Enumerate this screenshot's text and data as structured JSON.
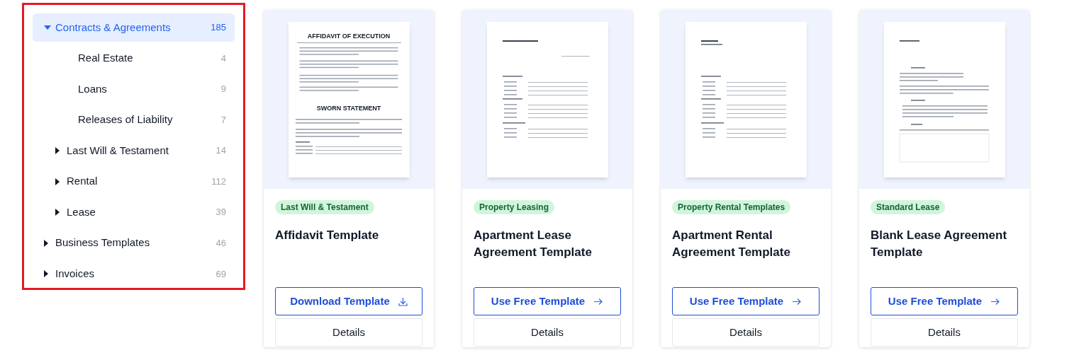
{
  "sidebar": {
    "highlighted": true,
    "items": [
      {
        "label": "Contracts & Agreements",
        "count": "185",
        "expanded": true,
        "selected": true,
        "children": [
          {
            "label": "Real Estate",
            "count": "4",
            "selected": false
          },
          {
            "label": "Loans",
            "count": "9",
            "selected": false
          },
          {
            "label": "Releases of Liability",
            "count": "7",
            "selected": false
          },
          {
            "label": "Last Will & Testament",
            "count": "14",
            "expanded": false,
            "selected": false
          },
          {
            "label": "Rental",
            "count": "112",
            "expanded": false,
            "selected": false
          },
          {
            "label": "Lease",
            "count": "39",
            "expanded": false,
            "selected": false
          }
        ]
      },
      {
        "label": "Business Templates",
        "count": "46",
        "expanded": false,
        "selected": false
      },
      {
        "label": "Invoices",
        "count": "69",
        "expanded": false,
        "selected": false
      }
    ]
  },
  "cards": [
    {
      "preview": {
        "kind": "affidavit",
        "headings": [
          "AFFIDAVIT OF EXECUTION",
          "SWORN STATEMENT"
        ]
      },
      "badge": "Last Will & Testament",
      "title": "Affidavit Template",
      "primary": {
        "label": "Download Template",
        "kind": "download"
      },
      "secondary": "Details"
    },
    {
      "preview": {
        "kind": "form"
      },
      "badge": "Property Leasing",
      "title": "Apartment Lease Agreement Template",
      "primary": {
        "label": "Use Free Template",
        "kind": "arrow"
      },
      "secondary": "Details"
    },
    {
      "preview": {
        "kind": "form"
      },
      "badge": "Property Rental Templates",
      "title": "Apartment Rental Agreement Template",
      "primary": {
        "label": "Use Free Template",
        "kind": "arrow"
      },
      "secondary": "Details"
    },
    {
      "preview": {
        "kind": "lease"
      },
      "badge": "Standard Lease",
      "title": "Blank Lease Agreement Template",
      "primary": {
        "label": "Use Free Template",
        "kind": "arrow"
      },
      "secondary": "Details"
    }
  ]
}
